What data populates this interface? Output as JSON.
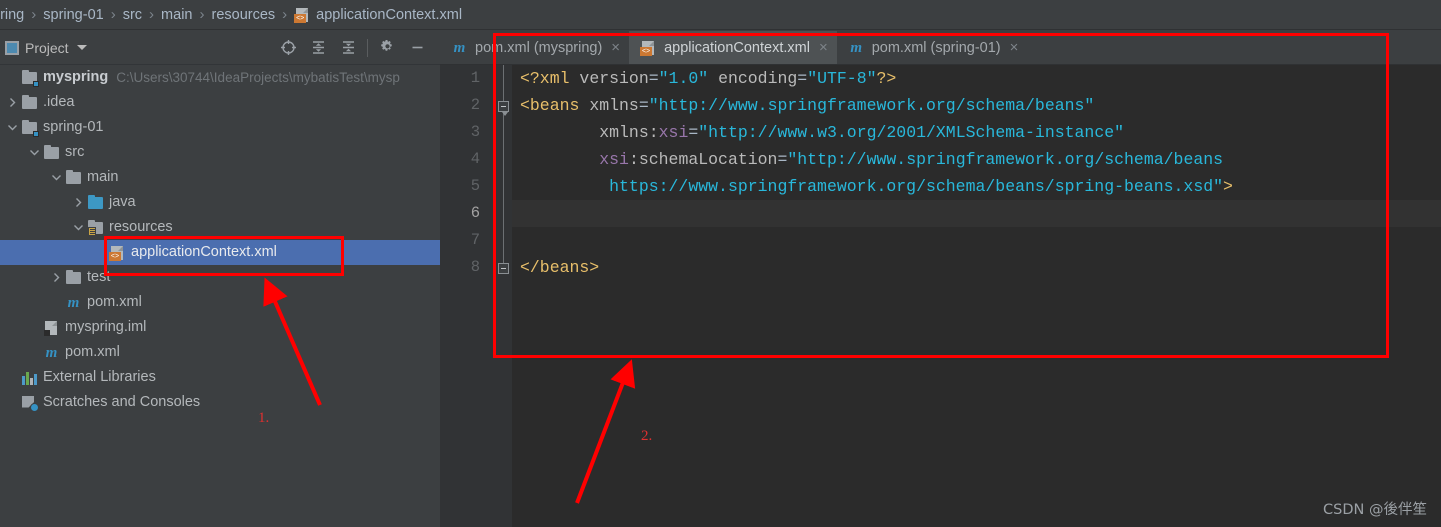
{
  "breadcrumb": {
    "items": [
      {
        "label": "pring",
        "icon": "none"
      },
      {
        "label": "spring-01",
        "icon": "none"
      },
      {
        "label": "src",
        "icon": "none"
      },
      {
        "label": "main",
        "icon": "none"
      },
      {
        "label": "resources",
        "icon": "none"
      },
      {
        "label": "applicationContext.xml",
        "icon": "xml-file-icon"
      }
    ],
    "separator": "›"
  },
  "sidebar": {
    "title": "Project",
    "tools": [
      {
        "name": "locate-icon",
        "tooltip": "Select Opened File"
      },
      {
        "name": "expand-all-icon",
        "tooltip": "Expand All"
      },
      {
        "name": "collapse-all-icon",
        "tooltip": "Collapse All"
      },
      {
        "name": "settings-gear-icon",
        "tooltip": "Settings"
      },
      {
        "name": "hide-icon",
        "tooltip": "Hide"
      }
    ],
    "tree": [
      {
        "label": "myspring",
        "path": "C:\\Users\\30744\\IdeaProjects\\mybatisTest\\mysp",
        "icon": "project-folder-icon",
        "depth": 0,
        "arrow": "none",
        "bold": true,
        "selected": false
      },
      {
        "label": ".idea",
        "path": "",
        "icon": "folder-icon",
        "depth": 1,
        "arrow": "collapsed",
        "bold": false,
        "selected": false
      },
      {
        "label": "spring-01",
        "path": "",
        "icon": "module-folder-icon",
        "depth": 1,
        "arrow": "expanded",
        "bold": false,
        "selected": false
      },
      {
        "label": "src",
        "path": "",
        "icon": "folder-icon",
        "depth": 2,
        "arrow": "expanded",
        "bold": false,
        "selected": false
      },
      {
        "label": "main",
        "path": "",
        "icon": "folder-icon",
        "depth": 3,
        "arrow": "expanded",
        "bold": false,
        "selected": false
      },
      {
        "label": "java",
        "path": "",
        "icon": "source-folder-icon",
        "depth": 4,
        "arrow": "collapsed",
        "bold": false,
        "selected": false
      },
      {
        "label": "resources",
        "path": "",
        "icon": "resource-folder-icon",
        "depth": 4,
        "arrow": "expanded",
        "bold": false,
        "selected": false
      },
      {
        "label": "applicationContext.xml",
        "path": "",
        "icon": "xml-file-icon",
        "depth": 5,
        "arrow": "none",
        "bold": false,
        "selected": true
      },
      {
        "label": "test",
        "path": "",
        "icon": "folder-icon",
        "depth": 3,
        "arrow": "collapsed",
        "bold": false,
        "selected": false
      },
      {
        "label": "pom.xml",
        "path": "",
        "icon": "maven-icon",
        "depth": 3,
        "arrow": "none",
        "bold": false,
        "selected": false
      },
      {
        "label": "myspring.iml",
        "path": "",
        "icon": "iml-file-icon",
        "depth": 2,
        "arrow": "none",
        "bold": false,
        "selected": false
      },
      {
        "label": "pom.xml",
        "path": "",
        "icon": "maven-icon",
        "depth": 2,
        "arrow": "none",
        "bold": false,
        "selected": false
      },
      {
        "label": "External Libraries",
        "path": "",
        "icon": "external-libraries-icon",
        "depth": 1,
        "arrow": "none",
        "bold": false,
        "selected": false
      },
      {
        "label": "Scratches and Consoles",
        "path": "",
        "icon": "scratches-icon",
        "depth": 1,
        "arrow": "none",
        "bold": false,
        "selected": false
      }
    ]
  },
  "editor": {
    "tabs": [
      {
        "label": "pom.xml (myspring)",
        "icon": "maven-icon",
        "active": false,
        "close": "×"
      },
      {
        "label": "applicationContext.xml",
        "icon": "xml-file-icon",
        "active": true,
        "close": "×"
      },
      {
        "label": "pom.xml (spring-01)",
        "icon": "maven-icon",
        "active": false,
        "close": "×"
      }
    ],
    "line_numbers": [
      "1",
      "2",
      "3",
      "4",
      "5",
      "6",
      "7",
      "8"
    ],
    "current_line": 6,
    "lines": [
      {
        "n": 1,
        "tokens": [
          {
            "t": "<?xml ",
            "c": "t-pi"
          },
          {
            "t": "version",
            "c": "t-attr"
          },
          {
            "t": "=",
            "c": "t-punct"
          },
          {
            "t": "\"1.0\"",
            "c": "t-val"
          },
          {
            "t": " ",
            "c": "t-punct"
          },
          {
            "t": "encoding",
            "c": "t-attr"
          },
          {
            "t": "=",
            "c": "t-punct"
          },
          {
            "t": "\"UTF-8\"",
            "c": "t-val"
          },
          {
            "t": "?>",
            "c": "t-pi"
          }
        ]
      },
      {
        "n": 2,
        "tokens": [
          {
            "t": "<beans",
            "c": "t-tag"
          },
          {
            "t": " ",
            "c": "t-punct"
          },
          {
            "t": "xmlns",
            "c": "t-attr"
          },
          {
            "t": "=",
            "c": "t-punct"
          },
          {
            "t": "\"http://www.springframework.org/schema/beans\"",
            "c": "t-val"
          }
        ]
      },
      {
        "n": 3,
        "tokens": [
          {
            "t": "        ",
            "c": "t-punct"
          },
          {
            "t": "xmlns:",
            "c": "t-attr"
          },
          {
            "t": "xsi",
            "c": "t-ns"
          },
          {
            "t": "=",
            "c": "t-punct"
          },
          {
            "t": "\"http://www.w3.org/2001/XMLSchema-instance\"",
            "c": "t-val"
          }
        ]
      },
      {
        "n": 4,
        "tokens": [
          {
            "t": "        ",
            "c": "t-punct"
          },
          {
            "t": "xsi",
            "c": "t-ns"
          },
          {
            "t": ":schemaLocation",
            "c": "t-attr"
          },
          {
            "t": "=",
            "c": "t-punct"
          },
          {
            "t": "\"http://www.springframework.org/schema/beans",
            "c": "t-val"
          }
        ]
      },
      {
        "n": 5,
        "tokens": [
          {
            "t": "         ",
            "c": "t-punct"
          },
          {
            "t": "https://www.springframework.org/schema/beans/spring-beans.xsd\"",
            "c": "t-val"
          },
          {
            "t": ">",
            "c": "t-tag"
          }
        ]
      },
      {
        "n": 6,
        "tokens": []
      },
      {
        "n": 7,
        "tokens": []
      },
      {
        "n": 8,
        "tokens": [
          {
            "t": "</beans>",
            "c": "t-tag"
          }
        ]
      }
    ]
  },
  "annotations": {
    "marker_one": "1.",
    "marker_two": "2.",
    "accent_color": "#ff0000"
  },
  "watermark": "CSDN @後伴笙"
}
